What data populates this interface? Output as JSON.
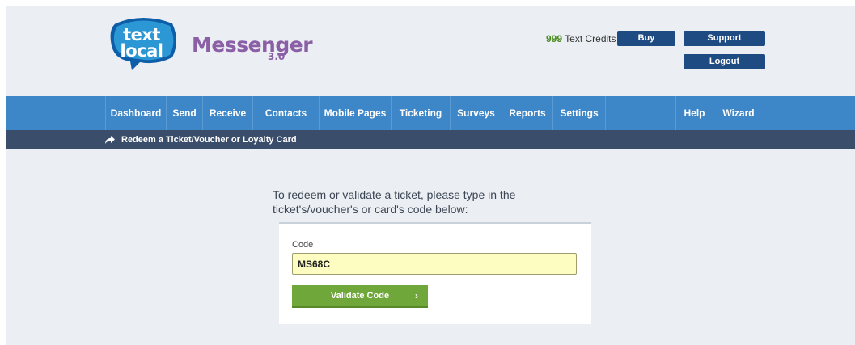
{
  "logo": {
    "line1": "text",
    "line2": "local"
  },
  "product": {
    "name": "Messenger",
    "version": "3.0"
  },
  "header": {
    "credits_count": "999",
    "credits_label": " Text Credits",
    "buy_label": "Buy",
    "support_label": "Support",
    "logout_label": "Logout"
  },
  "nav": {
    "items": [
      "Dashboard",
      "Send",
      "Receive",
      "Contacts",
      "Mobile Pages",
      "Ticketing",
      "Surveys",
      "Reports",
      "Settings",
      "Help",
      "Wizard"
    ]
  },
  "breadcrumb": {
    "icon": "share-arrow-icon",
    "label": "Redeem a Ticket/Voucher or Loyalty Card"
  },
  "main": {
    "instruction": "To redeem or validate a ticket, please type in the ticket's/voucher's or card's code below:",
    "code_label": "Code",
    "code_value": "MS68C",
    "validate_label": "Validate Code",
    "validate_chevron": "›"
  },
  "colors": {
    "nav_bg": "#3d86c7",
    "breadcrumb_bg": "#3a4e6b",
    "header_button": "#1f4b83",
    "validate_button": "#6fa73a",
    "logo_blue": "#2b97d4",
    "product_purple": "#8b5fa6",
    "credits_green": "#4a8c22"
  }
}
